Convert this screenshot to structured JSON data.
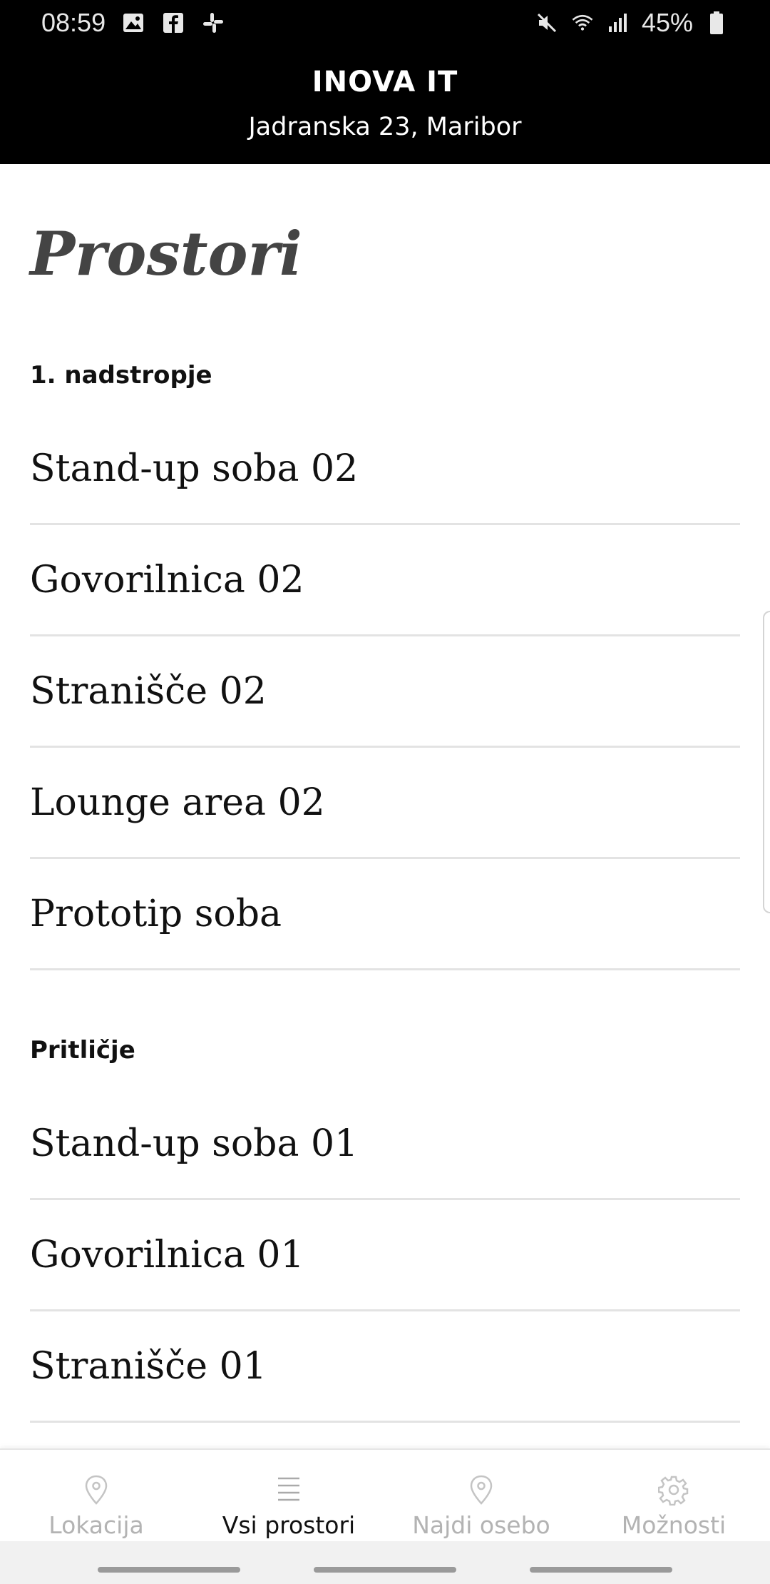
{
  "status_bar": {
    "time": "08:59",
    "battery": "45%",
    "left_icons": [
      "gallery-icon",
      "facebook-icon",
      "slack-icon"
    ],
    "right_icons": [
      "mute-icon",
      "wifi-icon",
      "signal-icon",
      "battery-icon"
    ]
  },
  "header": {
    "title": "INOVA IT",
    "subtitle": "Jadranska 23, Maribor"
  },
  "main": {
    "page_title": "Prostori",
    "sections": [
      {
        "label": "1. nadstropje",
        "rooms": [
          "Stand-up soba 02",
          "Govorilnica 02",
          "Stranišče 02",
          "Lounge area 02",
          "Prototip soba"
        ]
      },
      {
        "label": "Pritličje",
        "rooms": [
          "Stand-up soba 01",
          "Govorilnica 01",
          "Stranišče 01"
        ]
      }
    ]
  },
  "bottom_nav": {
    "items": [
      {
        "label": "Lokacija",
        "icon": "location-pin-icon",
        "active": false
      },
      {
        "label": "Vsi prostori",
        "icon": "list-icon",
        "active": true
      },
      {
        "label": "Najdi osebo",
        "icon": "location-pin-icon",
        "active": false
      },
      {
        "label": "Možnosti",
        "icon": "gear-icon",
        "active": false
      }
    ]
  },
  "colors": {
    "header_bg": "#000000",
    "active_nav": "#111111",
    "inactive_nav": "#b3b3b3",
    "divider": "#e3e3e3"
  }
}
